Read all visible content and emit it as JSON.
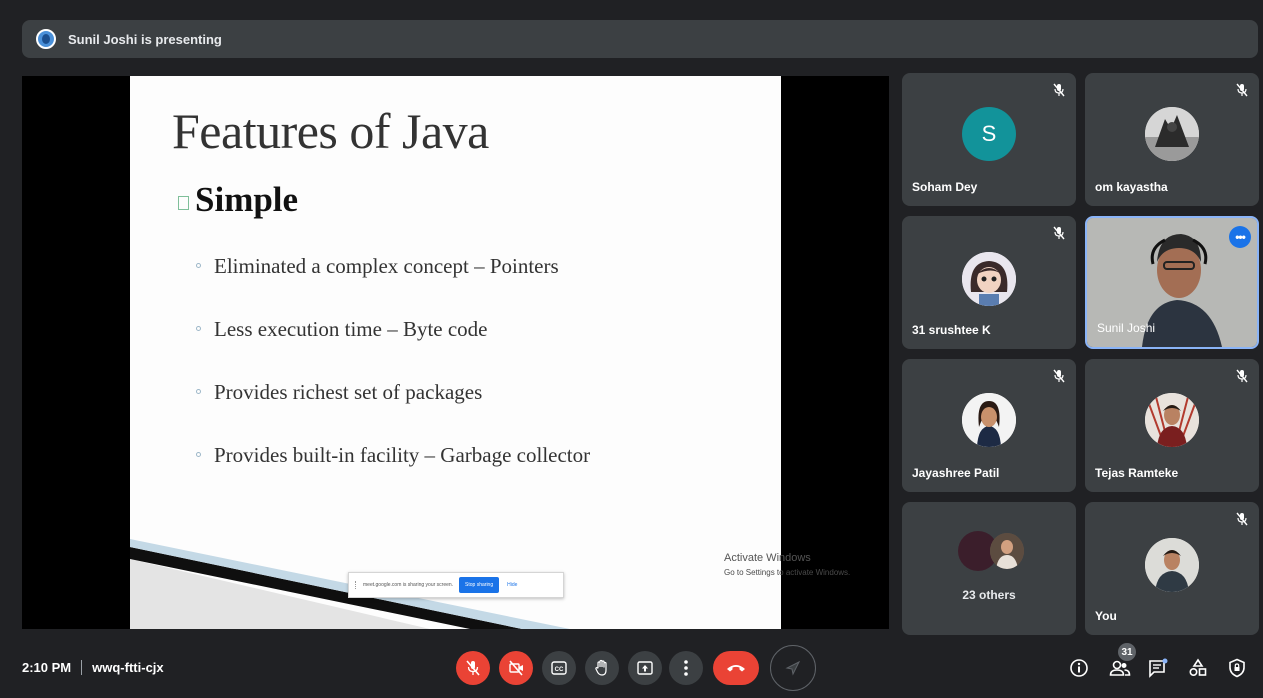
{
  "banner": {
    "presenter_text": "Sunil Joshi is presenting"
  },
  "slide": {
    "title": "Features of Java",
    "heading": "Simple",
    "bullets": [
      "Eliminated a complex concept – Pointers",
      "Less execution time – Byte code",
      "Provides richest set of packages",
      "Provides built-in facility – Garbage collector"
    ],
    "share_notice": {
      "text": "meet.google.com is sharing your screen.",
      "stop_label": "Stop sharing",
      "hide_label": "Hide"
    },
    "watermark": {
      "line1": "Activate Windows",
      "line2": "Go to Settings to activate Windows."
    }
  },
  "participants": [
    {
      "name": "Soham Dey",
      "avatar": "S",
      "avatar_color": "#12939a",
      "muted": true
    },
    {
      "name": "om kayastha",
      "avatar_type": "photo",
      "muted": true
    },
    {
      "name": "31 srushtee K",
      "avatar_type": "cartoon",
      "muted": true
    },
    {
      "name": "Sunil Joshi",
      "video": true,
      "active_speaker": true
    },
    {
      "name": "Jayashree Patil",
      "avatar_type": "photo",
      "muted": true
    },
    {
      "name": "Tejas Ramteke",
      "avatar_type": "photo",
      "muted": true
    },
    {
      "name": "23 others",
      "group": true
    },
    {
      "name": "You",
      "avatar_type": "photo",
      "muted": true
    }
  ],
  "meeting": {
    "time": "2:10 PM",
    "code": "wwq-ftti-cjx"
  },
  "controls": {
    "mic": "mic-off-icon",
    "camera": "camera-off-icon",
    "captions": "closed-captions-icon",
    "hand": "raise-hand-icon",
    "present": "present-screen-icon",
    "more": "more-options-icon",
    "leave": "end-call-icon",
    "companion": "send-icon"
  },
  "side_tools": {
    "people_count": "31"
  },
  "colors": {
    "background": "#202124",
    "tile": "#3c4043",
    "danger": "#ea4335",
    "accent": "#1a73e8",
    "active_border": "#8ab4f8"
  }
}
